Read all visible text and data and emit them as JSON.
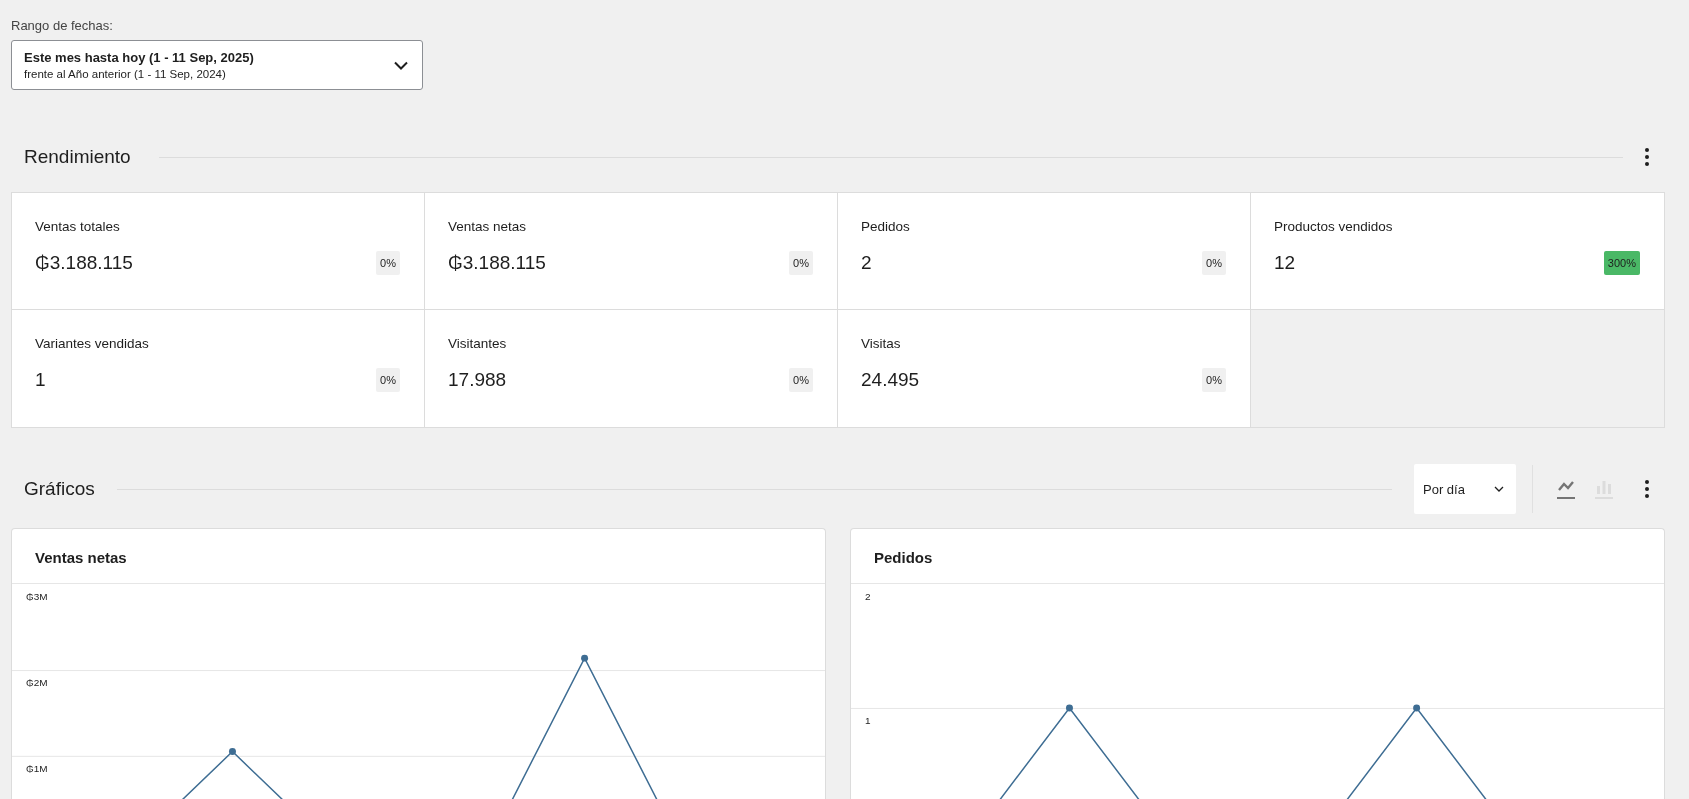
{
  "date_range": {
    "label": "Rango de fechas:",
    "primary": "Este mes hasta hoy (1 - 11 Sep, 2025)",
    "secondary": "frente al Año anterior (1 - 11 Sep, 2024)"
  },
  "performance": {
    "title": "Rendimiento",
    "stats": [
      {
        "label": "Ventas totales",
        "value": "₲3.188.115",
        "delta": "0%",
        "positive": false
      },
      {
        "label": "Ventas netas",
        "value": "₲3.188.115",
        "delta": "0%",
        "positive": false
      },
      {
        "label": "Pedidos",
        "value": "2",
        "delta": "0%",
        "positive": false
      },
      {
        "label": "Productos vendidos",
        "value": "12",
        "delta": "300%",
        "positive": true
      },
      {
        "label": "Variantes vendidas",
        "value": "1",
        "delta": "0%",
        "positive": false
      },
      {
        "label": "Visitantes",
        "value": "17.988",
        "delta": "0%",
        "positive": false
      },
      {
        "label": "Visitas",
        "value": "24.495",
        "delta": "0%",
        "positive": false
      }
    ]
  },
  "charts_section": {
    "title": "Gráficos",
    "interval": "Por día",
    "chart_types": [
      {
        "kind": "line",
        "selected": true
      },
      {
        "kind": "bar",
        "selected": false
      }
    ],
    "charts": [
      {
        "title": "Ventas netas",
        "y_labels": [
          "₲3M",
          "₲2M",
          "₲1M"
        ]
      },
      {
        "title": "Pedidos",
        "y_labels": [
          "2",
          "1"
        ]
      }
    ]
  }
}
